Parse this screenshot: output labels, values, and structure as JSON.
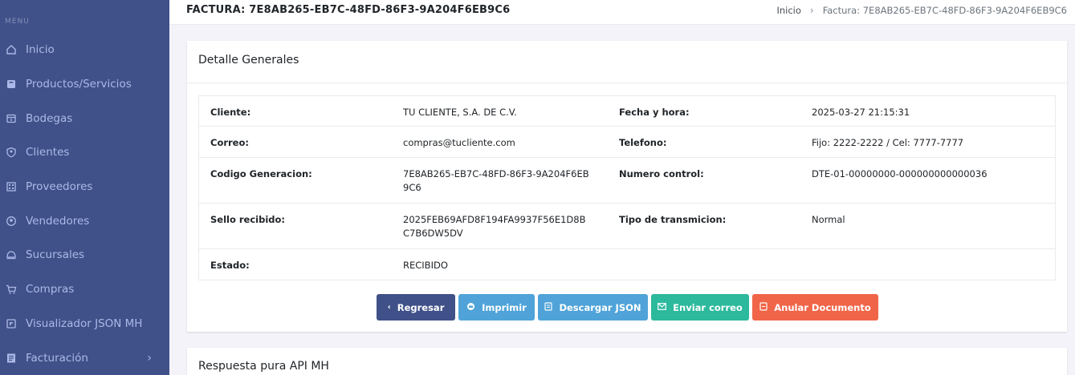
{
  "sidebar": {
    "menu_title": "MENU",
    "items": [
      {
        "label": "Inicio",
        "icon": "home-icon"
      },
      {
        "label": "Productos/Servicios",
        "icon": "box-icon"
      },
      {
        "label": "Bodegas",
        "icon": "warehouse-icon"
      },
      {
        "label": "Clientes",
        "icon": "shield-user-icon"
      },
      {
        "label": "Proveedores",
        "icon": "building-icon"
      },
      {
        "label": "Vendedores",
        "icon": "user-circle-icon"
      },
      {
        "label": "Sucursales",
        "icon": "store-icon"
      },
      {
        "label": "Compras",
        "icon": "cart-icon"
      },
      {
        "label": "Visualizador JSON MH",
        "icon": "json-icon"
      },
      {
        "label": "Facturación",
        "icon": "invoice-icon",
        "chevron": "›"
      }
    ]
  },
  "header": {
    "title": "FACTURA: 7E8AB265-EB7C-48FD-86F3-9A204F6EB9C6",
    "breadcrumb_home": "Inicio",
    "breadcrumb_sep": "›",
    "breadcrumb_current": "Factura: 7E8AB265-EB7C-48FD-86F3-9A204F6EB9C6"
  },
  "details": {
    "title": "Detalle Generales",
    "rows": [
      {
        "l1": "Cliente:",
        "v1": "TU CLIENTE, S.A. DE C.V.",
        "l2": "Fecha y hora:",
        "v2": "2025-03-27 21:15:31"
      },
      {
        "l1": "Correo:",
        "v1": "compras@tucliente.com",
        "l2": "Telefono:",
        "v2": "Fijo: 2222-2222 / Cel: 7777-7777"
      },
      {
        "l1": "Codigo Generacion:",
        "v1": "7E8AB265-EB7C-48FD-86F3-9A204F6EB9C6",
        "l2": "Numero control:",
        "v2": "DTE-01-00000000-000000000000036"
      },
      {
        "l1": "Sello recibido:",
        "v1": "2025FEB69AFD8F194FA9937F56E1D8BC7B6DW5DV",
        "l2": "Tipo de transmicion:",
        "v2": "Normal"
      },
      {
        "l1": "Estado:",
        "v1": "RECIBIDO",
        "l2": "",
        "v2": ""
      }
    ]
  },
  "buttons": {
    "back": "Regresar",
    "print": "Imprimir",
    "json": "Descargar JSON",
    "mail": "Enviar correo",
    "cancel": "Anular Documento"
  },
  "api": {
    "title": "Respuesta pura API MH"
  },
  "colors": {
    "sidebar": "#405189",
    "primary": "#405189",
    "info": "#4fa3d8",
    "success": "#2cb99c",
    "danger": "#f06548"
  }
}
